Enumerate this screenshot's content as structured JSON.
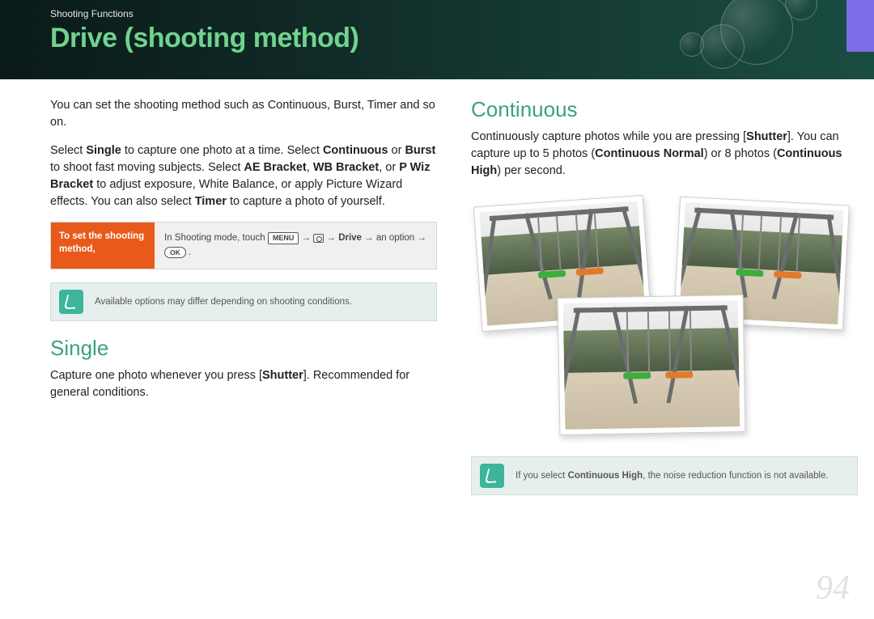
{
  "header": {
    "breadcrumb": "Shooting Functions",
    "title": "Drive (shooting method)"
  },
  "intro": {
    "p1": "You can set the shooting method such as Continuous, Burst, Timer and so on.",
    "p2_pre": "Select ",
    "p2_b1": "Single",
    "p2_mid1": " to capture one photo at a time. Select ",
    "p2_b2": "Continuous",
    "p2_mid2": " or ",
    "p2_b3": "Burst",
    "p2_mid3": " to shoot fast moving subjects. Select ",
    "p2_b4": "AE Bracket",
    "p2_mid4": ", ",
    "p2_b5": "WB Bracket",
    "p2_mid5": ", or ",
    "p2_b6": "P Wiz Bracket",
    "p2_mid6": " to adjust exposure, White Balance, or apply Picture Wizard effects. You can also select ",
    "p2_b7": "Timer",
    "p2_end": " to capture a photo of yourself."
  },
  "set_box": {
    "label": "To set the shooting method,",
    "body_pre": "In Shooting mode, touch ",
    "menu": "MENU",
    "arrow": " → ",
    "drive": "Drive",
    "body_mid": " → an option → ",
    "ok": "OK",
    "body_end": "."
  },
  "note_left": "Available options may differ depending on shooting conditions.",
  "single": {
    "heading": "Single",
    "body_pre": "Capture one photo whenever you press [",
    "shutter": "Shutter",
    "body_post": "]. Recommended for general conditions."
  },
  "continuous": {
    "heading": "Continuous",
    "body_pre": "Continuously capture photos while you are pressing [",
    "shutter": "Shutter",
    "body_mid": "]. You can capture up to 5 photos (",
    "cn": "Continuous Normal",
    "body_mid2": ") or 8 photos (",
    "ch": "Continuous High",
    "body_end": ") per second."
  },
  "note_right_pre": "If you select ",
  "note_right_b": "Continuous High",
  "note_right_post": ", the noise reduction function is not available.",
  "page_number": "94"
}
